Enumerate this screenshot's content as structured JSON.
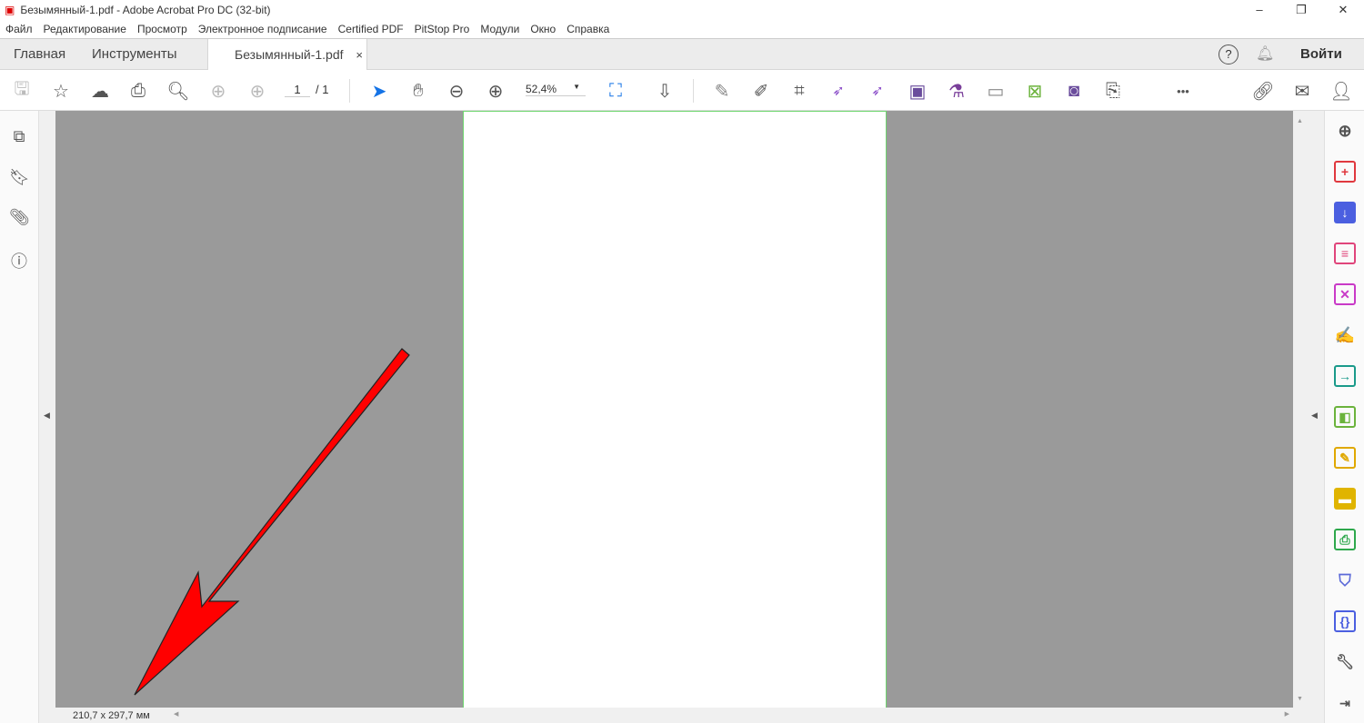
{
  "window": {
    "title": "Безымянный-1.pdf - Adobe Acrobat Pro DC (32-bit)",
    "minimize": "–",
    "maximize": "❐",
    "close": "✕"
  },
  "menu": [
    "Файл",
    "Редактирование",
    "Просмотр",
    "Электронное подписание",
    "Certified PDF",
    "PitStop Pro",
    "Модули",
    "Окно",
    "Справка"
  ],
  "tabs": {
    "home": "Главная",
    "tools": "Инструменты",
    "document": "Безымянный-1.pdf",
    "close": "×",
    "signin": "Войти"
  },
  "toolbar": {
    "page_current": "1",
    "page_total": "/ 1",
    "zoom": "52,4%",
    "more": "•••"
  },
  "status": {
    "page_size": "210,7 x 297,7 мм"
  },
  "colors": {
    "accent": "#1473e6",
    "page_border": "#6fd66f",
    "canvas": "#9a9a9a",
    "arrow": "#ff0000"
  }
}
